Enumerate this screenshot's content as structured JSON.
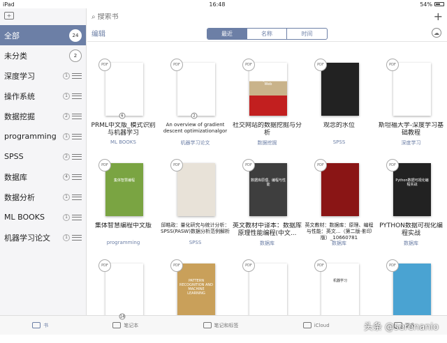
{
  "status": {
    "device": "iPad",
    "time": "16:48",
    "battery": "54%"
  },
  "sidebar": {
    "items": [
      {
        "label": "全部",
        "count": "24",
        "active": true
      },
      {
        "label": "未分类",
        "count": "2"
      },
      {
        "label": "深度学习",
        "count": "1"
      },
      {
        "label": "操作系统",
        "count": "1"
      },
      {
        "label": "数据挖掘",
        "count": "2"
      },
      {
        "label": "programming",
        "count": "1"
      },
      {
        "label": "SPSS",
        "count": "2"
      },
      {
        "label": "数据库",
        "count": "4"
      },
      {
        "label": "数据分析",
        "count": "1"
      },
      {
        "label": "ML BOOKS",
        "count": "1"
      },
      {
        "label": "机器学习论文",
        "count": "1"
      }
    ]
  },
  "search": {
    "placeholder": "搜索书"
  },
  "toolbar": {
    "edit": "编辑",
    "tabs": [
      "最近",
      "名称",
      "时间"
    ]
  },
  "books": [
    {
      "title": "PRML中文版_模式识别与机器学习",
      "tag": "ML BOOKS",
      "pg": "6",
      "cover": "c-white"
    },
    {
      "title": "An overview of gradient descent optimizationalgor",
      "tag": "机器学习论文",
      "pg": "2",
      "cover": "c-white",
      "small": true
    },
    {
      "title": "社交网站的数据挖掘与分析",
      "tag": "数据挖掘",
      "pg": "",
      "cover": "c-mining",
      "ctext": "Mining the Social Web"
    },
    {
      "title": "观念的水位",
      "tag": "SPSS",
      "pg": "",
      "cover": "c-water"
    },
    {
      "title": "斯坦福大学-深度学习基础教程",
      "tag": "深度学习",
      "pg": "",
      "cover": "c-white"
    },
    {
      "title": "集体智慧编程中文版",
      "tag": "programming",
      "pg": "",
      "cover": "c-green",
      "ctext": "集体智慧编程"
    },
    {
      "title": "邱皓政：量化研究与统计分析：SPSS(PASW)数据分析范例解析",
      "tag": "SPSS",
      "pg": "",
      "cover": "c-amzn",
      "small": true
    },
    {
      "title": "英文教材中译本：数据库原理性能编程(中文...",
      "tag": "数据库",
      "pg": "",
      "cover": "c-dark",
      "ctext": "数据库原理、编程与性能"
    },
    {
      "title": "英文教材：数据库：原理、编程与性能：英文...（第二版-影印版）_10660781",
      "tag": "数据库",
      "pg": "",
      "cover": "c-red",
      "small": true
    },
    {
      "title": "PYTHON数据可视化编程实战",
      "tag": "数据库",
      "pg": "",
      "cover": "c-py",
      "ctext": "Python数据可视化编程实战"
    },
    {
      "title": "",
      "tag": "",
      "pg": "14",
      "cover": "c-white"
    },
    {
      "title": "",
      "tag": "",
      "pg": "",
      "cover": "c-beige",
      "ctext": "PATTERN RECOGNITION AND MACHINE LEARNING"
    },
    {
      "title": "",
      "tag": "",
      "pg": "",
      "cover": "c-white"
    },
    {
      "title": "",
      "tag": "",
      "pg": "",
      "cover": "c-white",
      "ctext": "机器学习"
    },
    {
      "title": "",
      "tag": "",
      "pg": "",
      "cover": "c-pic"
    }
  ],
  "tabbar": {
    "items": [
      "书",
      "笔记本",
      "笔记和标签",
      "iCloud",
      "更多"
    ]
  },
  "watermark": "头条 @serenanio"
}
